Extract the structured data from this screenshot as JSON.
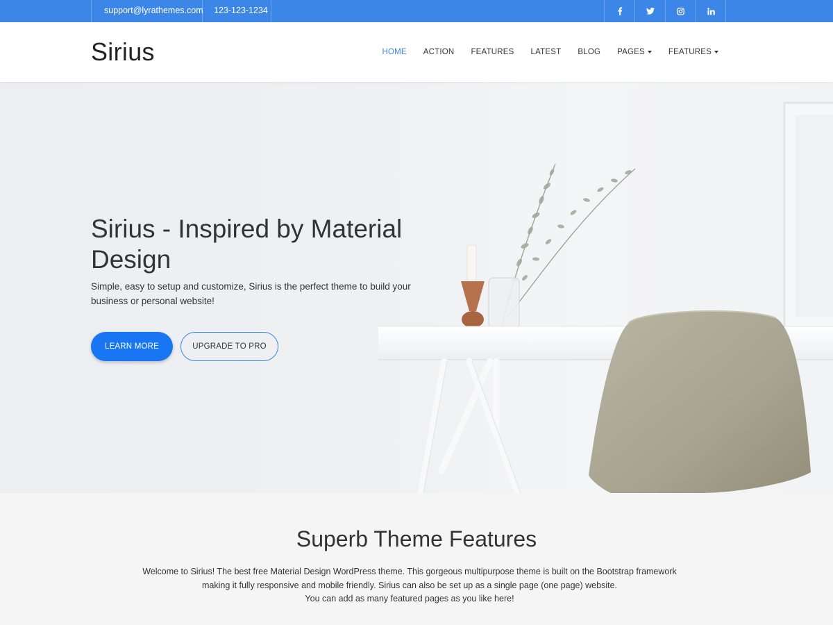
{
  "topbar": {
    "email": "support@lyrathemes.com",
    "phone": "123-123-1234",
    "social": [
      "facebook-icon",
      "twitter-icon",
      "instagram-icon",
      "linkedin-icon"
    ],
    "color": "#3b86e6"
  },
  "header": {
    "logo": "Sirius",
    "nav": {
      "home": "HOME",
      "action": "ACTION",
      "features": "FEATURES",
      "latest": "LATEST",
      "blog": "BLOG",
      "pages": "PAGES",
      "features_menu": "FEATURES"
    },
    "active_color": "#3b86e6"
  },
  "hero": {
    "title": "Sirius - Inspired by Material Design",
    "subtitle": "Simple, easy to setup and customize, Sirius is the perfect theme to build your business or personal website!",
    "primary_button": "LEARN MORE",
    "secondary_button": "UPGRADE TO PRO",
    "primary_color": "#1976f2"
  },
  "features": {
    "title": "Superb Theme Features",
    "line1": "Welcome to Sirius! The best free Material Design WordPress theme. This gorgeous multipurpose theme is built on the Bootstrap framework",
    "line2": "making it fully responsive and mobile friendly. Sirius can also be set up as a single page (one page) website.",
    "line3": "You can add as many featured pages as you like here!"
  }
}
